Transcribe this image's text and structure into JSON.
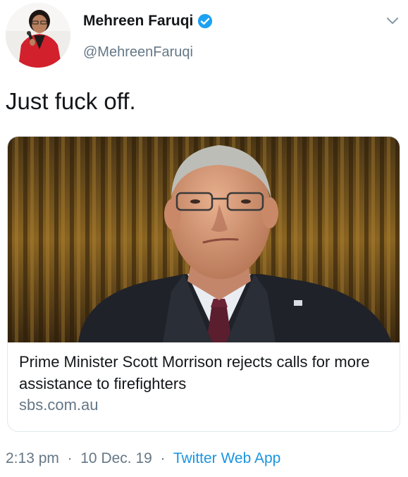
{
  "author": {
    "display_name": "Mehreen Faruqi",
    "handle": "@MehreenFaruqi",
    "verified": true
  },
  "tweet": {
    "text": "Just fuck off."
  },
  "card": {
    "title": "Prime Minister Scott Morrison rejects calls for more assistance to firefighters",
    "domain": "sbs.com.au"
  },
  "meta": {
    "time": "2:13 pm",
    "date": "10 Dec. 19",
    "source": "Twitter Web App",
    "separator": "·"
  },
  "icons": {
    "verified": "verified-badge-icon",
    "menu": "chevron-down-icon"
  },
  "colors": {
    "link": "#1b95e0",
    "verified": "#1da1f2",
    "secondary_text": "#657786"
  }
}
